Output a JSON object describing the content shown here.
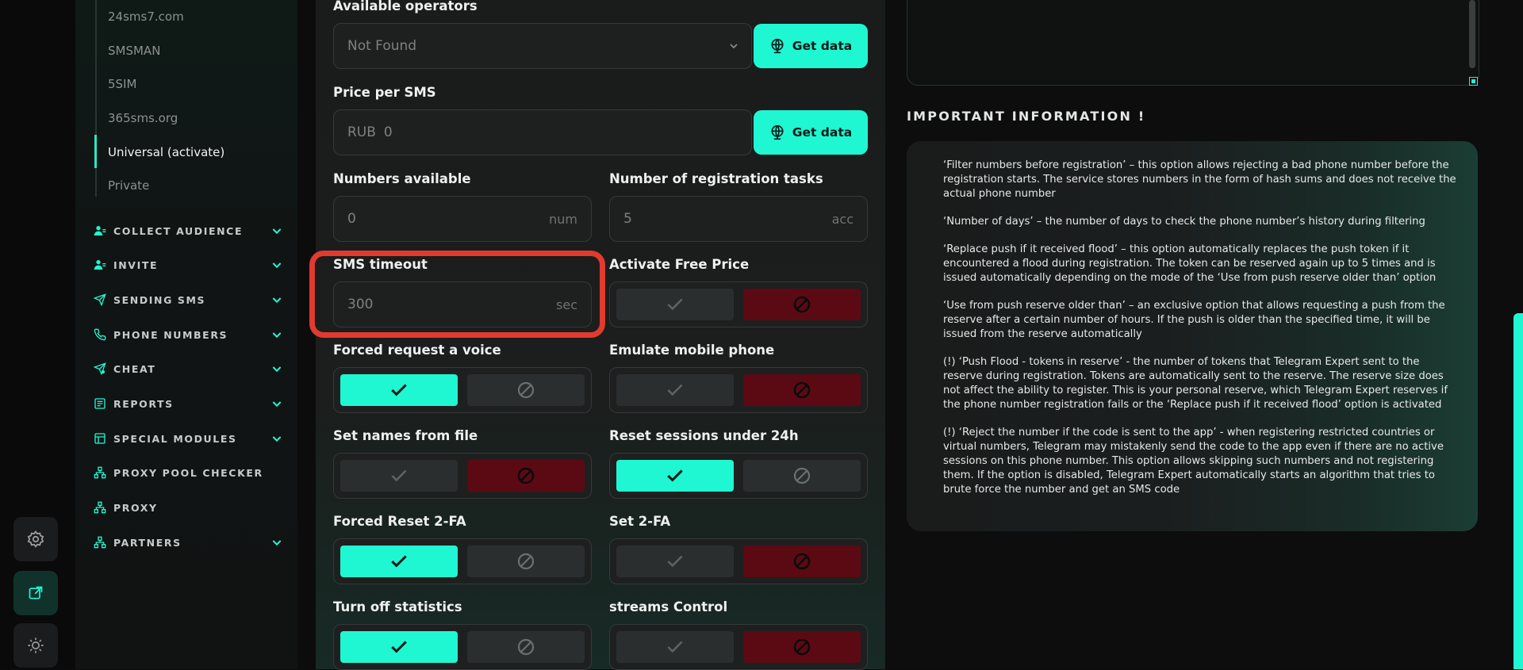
{
  "sidebar": {
    "sub_items": [
      {
        "label": "24sms7.com"
      },
      {
        "label": "SMSMAN"
      },
      {
        "label": "5SIM"
      },
      {
        "label": "365sms.org"
      },
      {
        "label": "Universal (activate)"
      },
      {
        "label": "Private"
      }
    ],
    "nav": [
      {
        "label": "COLLECT AUDIENCE",
        "icon": "users-icon",
        "chevron": true
      },
      {
        "label": "INVITE",
        "icon": "user-plus-icon",
        "chevron": true
      },
      {
        "label": "SENDING SMS",
        "icon": "send-icon",
        "chevron": true
      },
      {
        "label": "PHONE NUMBERS",
        "icon": "phone-icon",
        "chevron": true
      },
      {
        "label": "CHEAT",
        "icon": "send-star-icon",
        "chevron": true
      },
      {
        "label": "REPORTS",
        "icon": "report-icon",
        "chevron": true
      },
      {
        "label": "SPECIAL MODULES",
        "icon": "modules-icon",
        "chevron": true
      },
      {
        "label": "PROXY POOL CHECKER",
        "icon": "network-icon",
        "chevron": false
      },
      {
        "label": "PROXY",
        "icon": "network-icon",
        "chevron": false
      },
      {
        "label": "PARTNERS",
        "icon": "network-icon",
        "chevron": true
      }
    ]
  },
  "rail": {
    "buttons": [
      "gear-icon",
      "external-link-icon",
      "sun-icon"
    ]
  },
  "form": {
    "operators_label": "Available operators",
    "operators_value": "Not Found",
    "get_data_label": "Get data",
    "price_label": "Price per SMS",
    "price_prefix": "RUB",
    "price_value": "0",
    "numbers_label": "Numbers available",
    "numbers_placeholder": "0",
    "numbers_suffix": "num",
    "tasks_label": "Number of registration tasks",
    "tasks_placeholder": "5",
    "tasks_suffix": "acc",
    "timeout_label": "SMS timeout",
    "timeout_placeholder": "300",
    "timeout_suffix": "sec",
    "free_price_label": "Activate Free Price",
    "forced_voice_label": "Forced request a voice",
    "emulate_label": "Emulate mobile phone",
    "set_names_label": "Set names from file",
    "reset_sessions_label": "Reset sessions under 24h",
    "forced_reset_label": "Forced Reset 2-FA",
    "set_2fa_label": "Set 2-FA",
    "turn_off_stats_label": "Turn off statistics",
    "streams_label": "streams Control"
  },
  "toggles": {
    "free_price": false,
    "forced_voice": true,
    "emulate": false,
    "set_names": false,
    "reset_sessions": true,
    "forced_reset": true,
    "set_2fa": false,
    "turn_off_stats": true,
    "streams": false
  },
  "info": {
    "title": "IMPORTANT INFORMATION !",
    "paragraphs": [
      "‘Filter numbers before registration’ – this option allows rejecting a bad phone number before the registration starts. The service stores numbers in the form of hash sums and does not receive the actual phone number",
      "‘Number of days’ – the number of days to check the phone number’s history during filtering",
      "‘Replace push if it received flood’ – this option automatically replaces the push token if it encountered a flood during registration. The token can be reserved again up to 5 times and is issued automatically depending on the mode of the ‘Use from push reserve older than’ option",
      "‘Use from push reserve older than’ – an exclusive option that allows requesting a push from the reserve after a certain number of hours. If the push is older than the specified time, it will be issued from the reserve automatically",
      "(!) ‘Push Flood - tokens in reserve’ - the number of tokens that Telegram Expert sent to the reserve during registration. Tokens are automatically sent to the reserve. The reserve size does not affect the ability to register. This is your personal reserve, which Telegram Expert reserves if the phone number registration fails or the ‘Replace push if it received flood’ option is activated",
      "(!) ‘Reject the number if the code is sent to the app’ - when registering restricted countries or virtual numbers, Telegram may mistakenly send the code to the app even if there are no active sessions on this phone number. This option allows skipping such numbers and not registering them. If the option is disabled, Telegram Expert automatically starts an algorithm that tries to brute force the number and get an SMS code"
    ]
  },
  "colors": {
    "accent": "#1ff7d2",
    "danger": "#5b0a14",
    "highlight": "#e23a2e"
  }
}
